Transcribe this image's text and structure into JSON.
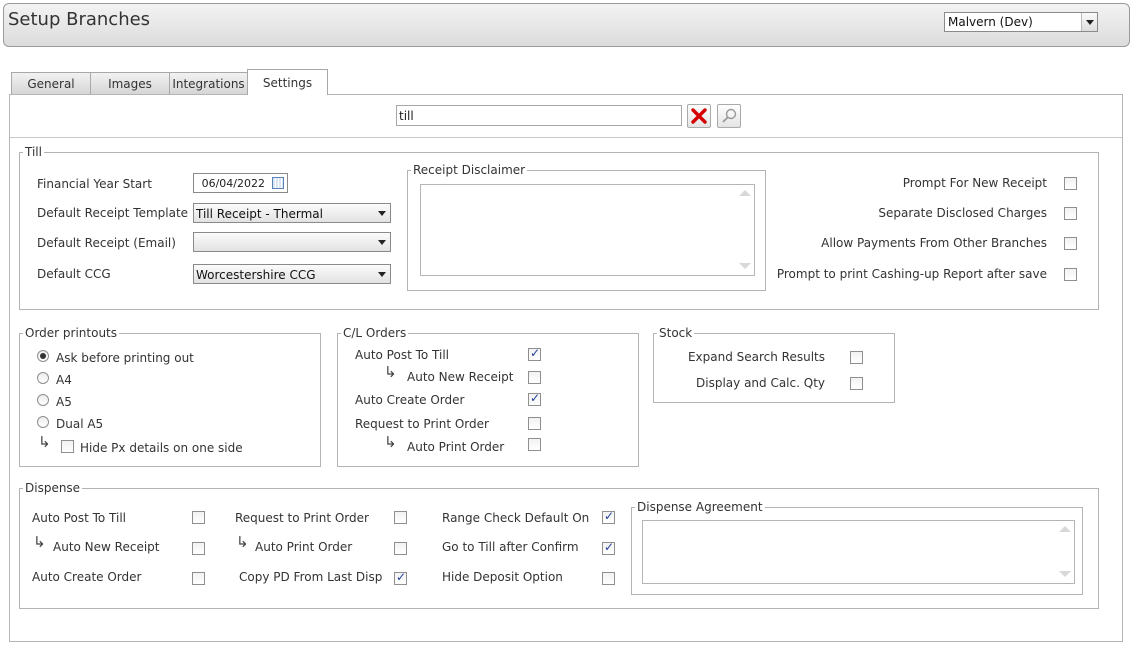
{
  "header": {
    "title": "Setup Branches",
    "branch_selected": "Malvern (Dev)"
  },
  "tabs": [
    {
      "label": "General"
    },
    {
      "label": "Images"
    },
    {
      "label": "Integrations"
    },
    {
      "label": "Settings",
      "active": true
    }
  ],
  "search": {
    "value": "till"
  },
  "till": {
    "legend": "Till",
    "financial_year_start_label": "Financial Year Start",
    "financial_year_start_value": "06/04/2022",
    "default_receipt_template_label": "Default Receipt Template",
    "default_receipt_template_value": "Till Receipt - Thermal",
    "default_receipt_email_label": "Default Receipt (Email)",
    "default_receipt_email_value": "",
    "default_ccg_label": "Default CCG",
    "default_ccg_value": "Worcestershire CCG",
    "receipt_disclaimer_legend": "Receipt Disclaimer",
    "receipt_disclaimer_value": "",
    "prompt_new_receipt_label": "Prompt For New Receipt",
    "prompt_new_receipt_checked": false,
    "separate_disclosed_label": "Separate Disclosed Charges",
    "separate_disclosed_checked": false,
    "allow_payments_label": "Allow Payments From Other Branches",
    "allow_payments_checked": false,
    "prompt_cashing_label": "Prompt to print Cashing-up Report after save",
    "prompt_cashing_checked": false
  },
  "order_printouts": {
    "legend": "Order printouts",
    "options": [
      {
        "label": "Ask before printing out",
        "checked": true
      },
      {
        "label": "A4",
        "checked": false
      },
      {
        "label": "A5",
        "checked": false
      },
      {
        "label": "Dual A5",
        "checked": false
      }
    ],
    "hide_px_label": "Hide Px details on one side",
    "hide_px_checked": false
  },
  "cl_orders": {
    "legend": "C/L Orders",
    "auto_post_label": "Auto Post To Till",
    "auto_post_checked": true,
    "auto_new_receipt_label": "Auto New Receipt",
    "auto_new_receipt_checked": false,
    "auto_create_order_label": "Auto Create Order",
    "auto_create_order_checked": true,
    "request_print_label": "Request to Print Order",
    "request_print_checked": false,
    "auto_print_label": "Auto Print Order",
    "auto_print_checked": false
  },
  "stock": {
    "legend": "Stock",
    "expand_search_label": "Expand Search Results",
    "expand_search_checked": false,
    "display_calc_label": "Display and Calc. Qty",
    "display_calc_checked": false
  },
  "dispense": {
    "legend": "Dispense",
    "auto_post_label": "Auto Post To Till",
    "auto_new_receipt_label": "Auto New Receipt",
    "auto_create_order_label": "Auto Create Order",
    "request_print_label": "Request to Print Order",
    "auto_print_label": "Auto Print Order",
    "copy_pd_label": "Copy PD From Last Disp",
    "range_check_label": "Range Check Default On",
    "go_to_till_label": "Go to Till after Confirm",
    "hide_deposit_label": "Hide Deposit Option",
    "agreement_legend": "Dispense Agreement",
    "agreement_value": ""
  }
}
